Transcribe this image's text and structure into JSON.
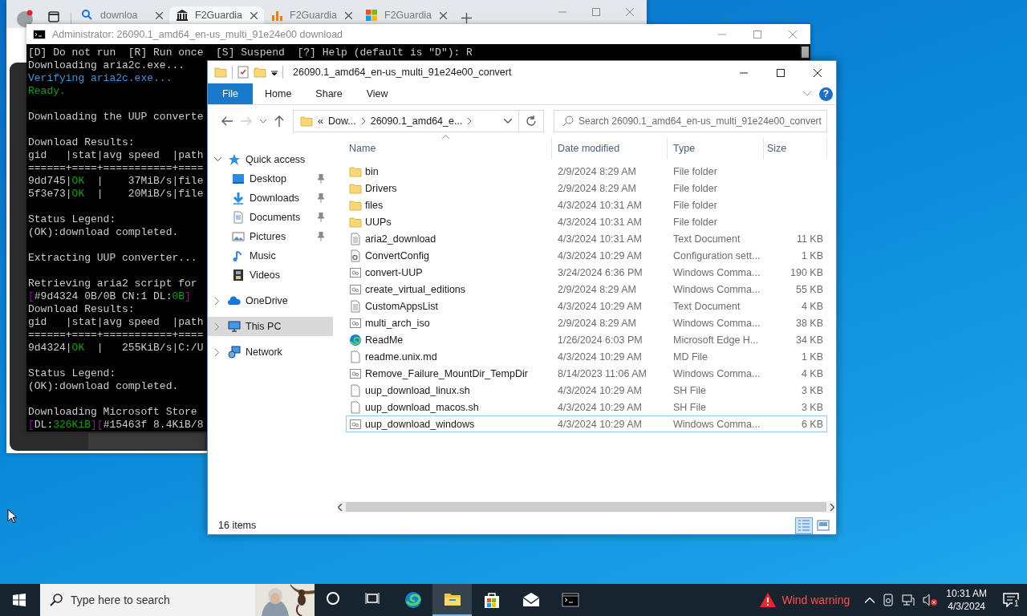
{
  "browser": {
    "tabs": [
      {
        "label": "downloa",
        "kind": "search",
        "selected": false
      },
      {
        "label": "F2Guardia",
        "kind": "columns",
        "selected": true
      },
      {
        "label": "F2Guardia",
        "kind": "bars",
        "selected": false
      },
      {
        "label": "F2Guardia",
        "kind": "squares",
        "selected": false
      }
    ]
  },
  "console": {
    "title": "Administrator:  26090.1_amd64_en-us_multi_91e24e00 download",
    "lines": [
      {
        "kind": "text",
        "segments": [
          {
            "text": "[D] Do not run  [R] Run once  [S] Suspend  [?] Help (default is \"D\"): R",
            "color": "#cccccc"
          }
        ]
      },
      {
        "kind": "text",
        "segments": [
          {
            "text": "Downloading aria2c.exe...",
            "color": "#cccccc"
          }
        ]
      },
      {
        "kind": "text",
        "segments": [
          {
            "text": "Verifying aria2c.exe...",
            "color": "#3a96dd"
          }
        ]
      },
      {
        "kind": "text",
        "segments": [
          {
            "text": "Ready.",
            "color": "#13a10e"
          }
        ]
      },
      {
        "kind": "blank"
      },
      {
        "kind": "text",
        "segments": [
          {
            "text": "Downloading the UUP converte",
            "color": "#cccccc"
          }
        ]
      },
      {
        "kind": "blank"
      },
      {
        "kind": "text",
        "segments": [
          {
            "text": "Download Results:",
            "color": "#cccccc"
          }
        ]
      },
      {
        "kind": "text",
        "segments": [
          {
            "text": "gid   |stat|avg speed  |path",
            "color": "#cccccc"
          }
        ]
      },
      {
        "kind": "text",
        "segments": [
          {
            "text": "======+====+===========+====",
            "color": "#cccccc"
          }
        ]
      },
      {
        "kind": "text",
        "segments": [
          {
            "text": "9dd745|",
            "color": "#cccccc"
          },
          {
            "text": "OK",
            "color": "#13a10e"
          },
          {
            "text": "  |    37MiB/s|file",
            "color": "#cccccc"
          }
        ]
      },
      {
        "kind": "text",
        "segments": [
          {
            "text": "5f3e73|",
            "color": "#cccccc"
          },
          {
            "text": "OK",
            "color": "#13a10e"
          },
          {
            "text": "  |    20MiB/s|file",
            "color": "#cccccc"
          }
        ]
      },
      {
        "kind": "blank"
      },
      {
        "kind": "text",
        "segments": [
          {
            "text": "Status Legend:",
            "color": "#cccccc"
          }
        ]
      },
      {
        "kind": "text",
        "segments": [
          {
            "text": "(OK):download completed.",
            "color": "#cccccc"
          }
        ]
      },
      {
        "kind": "blank"
      },
      {
        "kind": "text",
        "segments": [
          {
            "text": "Extracting UUP converter...",
            "color": "#cccccc"
          }
        ]
      },
      {
        "kind": "blank"
      },
      {
        "kind": "text",
        "segments": [
          {
            "text": "Retrieving aria2 script for",
            "color": "#cccccc"
          }
        ]
      },
      {
        "kind": "text",
        "segments": [
          {
            "text": "[",
            "color": "#881798"
          },
          {
            "text": "#9d4324 0B/0B CN:1 DL:",
            "color": "#cccccc"
          },
          {
            "text": "0B",
            "color": "#13a10e"
          },
          {
            "text": "]",
            "color": "#881798"
          }
        ]
      },
      {
        "kind": "text",
        "segments": [
          {
            "text": "Download Results:",
            "color": "#cccccc"
          }
        ]
      },
      {
        "kind": "text",
        "segments": [
          {
            "text": "gid   |stat|avg speed  |path",
            "color": "#cccccc"
          }
        ]
      },
      {
        "kind": "text",
        "segments": [
          {
            "text": "======+====+===========+====",
            "color": "#cccccc"
          }
        ]
      },
      {
        "kind": "text",
        "segments": [
          {
            "text": "9d4324|",
            "color": "#cccccc"
          },
          {
            "text": "OK",
            "color": "#13a10e"
          },
          {
            "text": "  |   255KiB/s|C:/U",
            "color": "#cccccc"
          }
        ]
      },
      {
        "kind": "blank"
      },
      {
        "kind": "text",
        "segments": [
          {
            "text": "Status Legend:",
            "color": "#cccccc"
          }
        ]
      },
      {
        "kind": "text",
        "segments": [
          {
            "text": "(OK):download completed.",
            "color": "#cccccc"
          }
        ]
      },
      {
        "kind": "blank"
      },
      {
        "kind": "text",
        "segments": [
          {
            "text": "Downloading Microsoft Store",
            "color": "#cccccc"
          }
        ]
      },
      {
        "kind": "text",
        "segments": [
          {
            "text": "[",
            "color": "#881798"
          },
          {
            "text": "DL:",
            "color": "#cccccc"
          },
          {
            "text": "326KiB",
            "color": "#13a10e"
          },
          {
            "text": "]",
            "color": "#881798"
          },
          {
            "text": "[",
            "color": "#881798"
          },
          {
            "text": "#15463f 8.4KiB/8",
            "color": "#cccccc"
          }
        ]
      }
    ]
  },
  "explorer": {
    "title": "26090.1_amd64_en-us_multi_91e24e00_convert",
    "ribbon_tabs": [
      {
        "label": "File",
        "kind": "menu"
      },
      {
        "label": "Home",
        "kind": "tab"
      },
      {
        "label": "Share",
        "kind": "tab"
      },
      {
        "label": "View",
        "kind": "tab"
      }
    ],
    "help_label": "?",
    "address": {
      "overflow_mark": "«",
      "segments": [
        "Dow...",
        "26090.1_amd64_e..."
      ]
    },
    "search": {
      "placeholder": "Search 26090.1_amd64_en-us_multi_91e24e00_convert"
    },
    "navigation": [
      {
        "label": "Quick access",
        "kind": "star",
        "expanded": true,
        "selected": false,
        "children": [
          {
            "label": "Desktop",
            "kind": "desktop",
            "pinned": true,
            "selected": false
          },
          {
            "label": "Downloads",
            "kind": "download",
            "pinned": true,
            "selected": false
          },
          {
            "label": "Documents",
            "kind": "document",
            "pinned": true,
            "selected": false
          },
          {
            "label": "Pictures",
            "kind": "pictures",
            "pinned": true,
            "selected": false
          },
          {
            "label": "Music",
            "kind": "music",
            "pinned": false,
            "selected": false
          },
          {
            "label": "Videos",
            "kind": "video",
            "pinned": false,
            "selected": false
          }
        ]
      },
      {
        "label": "OneDrive",
        "kind": "cloud",
        "expanded": false,
        "selected": false
      },
      {
        "label": "This PC",
        "kind": "computer",
        "expanded": false,
        "selected": true
      },
      {
        "label": "Network",
        "kind": "network",
        "expanded": false,
        "selected": false
      }
    ],
    "columns": [
      {
        "label": "Name",
        "sorted": true
      },
      {
        "label": "Date modified",
        "sorted": false
      },
      {
        "label": "Type",
        "sorted": false
      },
      {
        "label": "Size",
        "sorted": false
      }
    ],
    "files": [
      {
        "name": "bin",
        "kind": "folder",
        "date": "2/9/2024 8:29 AM",
        "type": "File folder",
        "selected": false
      },
      {
        "name": "Drivers",
        "kind": "folder",
        "date": "2/9/2024 8:29 AM",
        "type": "File folder",
        "selected": false
      },
      {
        "name": "files",
        "kind": "folder",
        "date": "4/3/2024 10:31 AM",
        "type": "File folder",
        "selected": false
      },
      {
        "name": "UUPs",
        "kind": "folder",
        "date": "4/3/2024 10:31 AM",
        "type": "File folder",
        "selected": false
      },
      {
        "name": "aria2_download",
        "kind": "text",
        "date": "4/3/2024 10:31 AM",
        "type": "Text Document",
        "size": "11 KB",
        "selected": false
      },
      {
        "name": "ConvertConfig",
        "kind": "config",
        "date": "4/3/2024 10:29 AM",
        "type": "Configuration sett...",
        "size": "1 KB",
        "selected": false
      },
      {
        "name": "convert-UUP",
        "kind": "command",
        "date": "3/24/2024 6:36 PM",
        "type": "Windows Comma...",
        "size": "190 KB",
        "selected": false
      },
      {
        "name": "create_virtual_editions",
        "kind": "command",
        "date": "2/9/2024 8:29 AM",
        "type": "Windows Comma...",
        "size": "55 KB",
        "selected": false
      },
      {
        "name": "CustomAppsList",
        "kind": "text",
        "date": "4/3/2024 10:29 AM",
        "type": "Text Document",
        "size": "4 KB",
        "selected": false
      },
      {
        "name": "multi_arch_iso",
        "kind": "command",
        "date": "2/9/2024 8:29 AM",
        "type": "Windows Comma...",
        "size": "38 KB",
        "selected": false
      },
      {
        "name": "ReadMe",
        "kind": "browser",
        "date": "1/26/2024 6:03 PM",
        "type": "Microsoft Edge H...",
        "size": "34 KB",
        "selected": false
      },
      {
        "name": "readme.unix.md",
        "kind": "blank",
        "date": "4/3/2024 10:29 AM",
        "type": "MD File",
        "size": "1 KB",
        "selected": false
      },
      {
        "name": "Remove_Failure_MountDir_TempDir",
        "kind": "command",
        "date": "8/14/2023 11:06 AM",
        "type": "Windows Comma...",
        "size": "4 KB",
        "selected": false
      },
      {
        "name": "uup_download_linux.sh",
        "kind": "blank",
        "date": "4/3/2024 10:29 AM",
        "type": "SH File",
        "size": "3 KB",
        "selected": false
      },
      {
        "name": "uup_download_macos.sh",
        "kind": "blank",
        "date": "4/3/2024 10:29 AM",
        "type": "SH File",
        "size": "3 KB",
        "selected": false
      },
      {
        "name": "uup_download_windows",
        "kind": "command",
        "date": "4/3/2024 10:29 AM",
        "type": "Windows Comma...",
        "size": "6 KB",
        "selected": true
      }
    ],
    "item_count": "16 items",
    "view_buttons": [
      {
        "kind": "details",
        "selected": true
      },
      {
        "kind": "preview",
        "selected": false
      }
    ]
  },
  "taskbar": {
    "search_placeholder": "Type here to search",
    "apps": [
      {
        "kind": "cortana",
        "selected": false
      },
      {
        "kind": "task-view",
        "selected": false
      },
      {
        "kind": "browser",
        "selected": false
      },
      {
        "kind": "explorer",
        "selected": true
      },
      {
        "kind": "store",
        "selected": false
      },
      {
        "kind": "mail",
        "selected": false
      },
      {
        "kind": "terminal",
        "selected": false
      }
    ],
    "weather": "Wind warning",
    "volume_muted": true,
    "time": "10:31 AM",
    "date": "4/3/2024",
    "notification_count": "1"
  }
}
